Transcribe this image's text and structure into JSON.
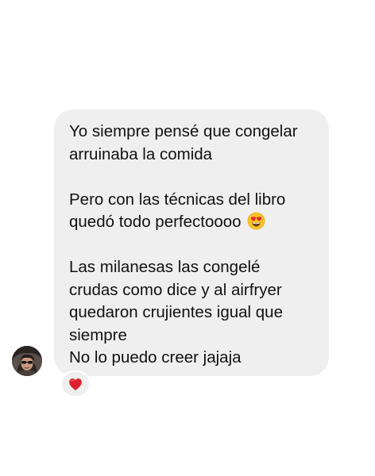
{
  "message": {
    "line1": "Yo siempre pensé que congelar",
    "line2": "arruinaba la comida",
    "line3": "Pero con las técnicas del libro",
    "line4": "quedó todo perfectoooo",
    "line5": "Las milanesas las congelé",
    "line6": "crudas como dice y al airfryer",
    "line7": "quedaron crujientes igual que",
    "line8": "siempre",
    "line9": "No lo puedo creer jajaja",
    "emoji_icon": "heart-eyes-face-icon"
  },
  "reaction": {
    "icon": "red-heart-icon",
    "color": "#e0202e"
  },
  "colors": {
    "bubble_background": "#efefef",
    "text": "#111111",
    "page_background": "#ffffff"
  }
}
